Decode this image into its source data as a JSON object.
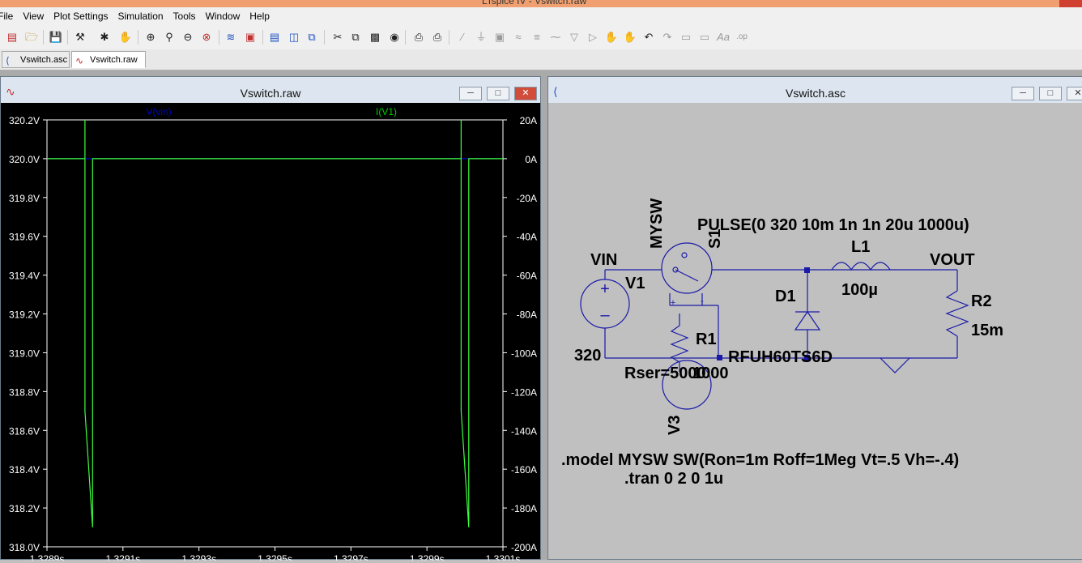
{
  "app_title": "LTspice IV - Vswitch.raw",
  "menu": [
    "File",
    "View",
    "Plot Settings",
    "Simulation",
    "Tools",
    "Window",
    "Help"
  ],
  "tabs": [
    {
      "label": "Vswitch.asc",
      "icon": "schematic-icon"
    },
    {
      "label": "Vswitch.raw",
      "icon": "waveform-icon",
      "active": true
    }
  ],
  "waveform_window": {
    "title": "Vswitch.raw",
    "traces": [
      {
        "label": "V(vin)",
        "color": "#0000c8"
      },
      {
        "label": "I(V1)",
        "color": "#00cc00"
      }
    ]
  },
  "schematic_window": {
    "title": "Vswitch.asc"
  },
  "chart_data": {
    "type": "line",
    "x_ticks": [
      "1.3289s",
      "1.3291s",
      "1.3293s",
      "1.3295s",
      "1.3297s",
      "1.3299s",
      "1.3301s"
    ],
    "y_left_ticks": [
      "320.2V",
      "320.0V",
      "319.8V",
      "319.6V",
      "319.4V",
      "319.2V",
      "319.0V",
      "318.8V",
      "318.6V",
      "318.4V",
      "318.2V",
      "318.0V"
    ],
    "y_right_ticks": [
      "20A",
      "0A",
      "-20A",
      "-40A",
      "-60A",
      "-80A",
      "-100A",
      "-120A",
      "-140A",
      "-160A",
      "-180A",
      "-200A"
    ],
    "xlim": [
      1.3289,
      1.3301
    ],
    "ylim_left": [
      318.0,
      320.2
    ],
    "ylim_right": [
      -200,
      20
    ],
    "series": [
      {
        "name": "V(vin)",
        "axis": "left",
        "x": [
          1.3289,
          1.3301
        ],
        "y": [
          320.0,
          320.0
        ]
      },
      {
        "name": "I(V1)",
        "axis": "right",
        "x": [
          1.3289,
          1.329,
          1.329,
          1.329,
          1.32902,
          1.32902,
          1.32902,
          1.32999,
          1.32999,
          1.32999,
          1.33001,
          1.33001,
          1.33001,
          1.3301
        ],
        "y": [
          0,
          0,
          20,
          -130,
          -190,
          -190,
          0,
          0,
          20,
          -130,
          -190,
          -190,
          0,
          0
        ]
      }
    ]
  },
  "schematic": {
    "labels": {
      "vin": "VIN",
      "vout": "VOUT",
      "v1": "V1",
      "v1_value": "320",
      "s1": "S1",
      "s1_model": "MYSW",
      "pulse": "PULSE(0 320 10m 1n 1n 20u 1000u)",
      "l1": "L1",
      "l1_value": "100µ",
      "d1": "D1",
      "d1_model": "RFUH60TS6D",
      "r1": "R1",
      "r1_value": "Rser=5000",
      "r1_value2": "1000",
      "r2": "R2",
      "r2_value": "15m",
      "v3": "V3",
      "model": ".model MYSW SW(Ron=1m Roff=1Meg Vt=.5 Vh=-.4)",
      "tran": ".tran 0 2 0 1u"
    }
  }
}
